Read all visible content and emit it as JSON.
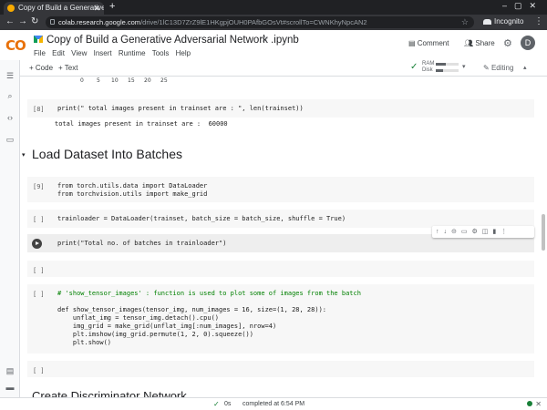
{
  "browser": {
    "tab_title": "Copy of Build a Generative",
    "new_tab": "+",
    "url_host": "colab.research.google.com",
    "url_path": "/drive/1lC13D7ZrZ9lE1HKgpjOUH0PAfbGOsVt#scrollTo=CWNKhyNpcAN2",
    "incognito_label": "Incognito"
  },
  "colab": {
    "logo_text": "CO",
    "notebook_title": "Copy of Build a Generative Adversarial Network .ipynb",
    "menu": [
      "File",
      "Edit",
      "View",
      "Insert",
      "Runtime",
      "Tools",
      "Help"
    ],
    "comment_label": "Comment",
    "share_label": "Share",
    "avatar_letter": "D",
    "add_code_label": "+ Code",
    "add_text_label": "+ Text",
    "ram_label": "RAM",
    "disk_label": "Disk",
    "ram_fill": 0.45,
    "disk_fill": 0.3,
    "editing_label": "Editing"
  },
  "notebook": {
    "axis_ticks": [
      "0",
      "5",
      "10",
      "15",
      "20",
      "25"
    ],
    "cell1": {
      "num": "[8]",
      "code": "print(\" total images present in trainset are : \", len(trainset))",
      "output": "total images present in trainset are :  60000"
    },
    "section_heading": "Load Dataset Into Batches",
    "cell2": {
      "num": "[9]",
      "line1": "from torch.utils.data import DataLoader",
      "line2": "from torchvision.utils import make_grid"
    },
    "cell3": {
      "num": "[ ]",
      "code": "trainloader = DataLoader(trainset, batch_size = batch_size, shuffle = True)"
    },
    "cell4": {
      "code": "print(\"Total no. of batches in trainloader\")"
    },
    "cell5": {
      "num": "[ ]"
    },
    "cell6": {
      "num": "[ ]",
      "comment": "# 'show_tensor_images' : function is used to plot some of images from the batch",
      "lines": [
        "def show_tensor_images(tensor_img, num_images = 16, size=(1, 28, 28)):",
        "    unflat_img = tensor_img.detach().cpu()",
        "    img_grid = make_grid(unflat_img[:num_images], nrow=4)",
        "    plt.imshow(img_grid.permute(1, 2, 0).squeeze())",
        "    plt.show()"
      ]
    },
    "cell7": {
      "num": "[ ]"
    },
    "next_heading": "Create Discriminator Network"
  },
  "status": {
    "time": "0s",
    "text": "completed at 6:54 PM"
  }
}
